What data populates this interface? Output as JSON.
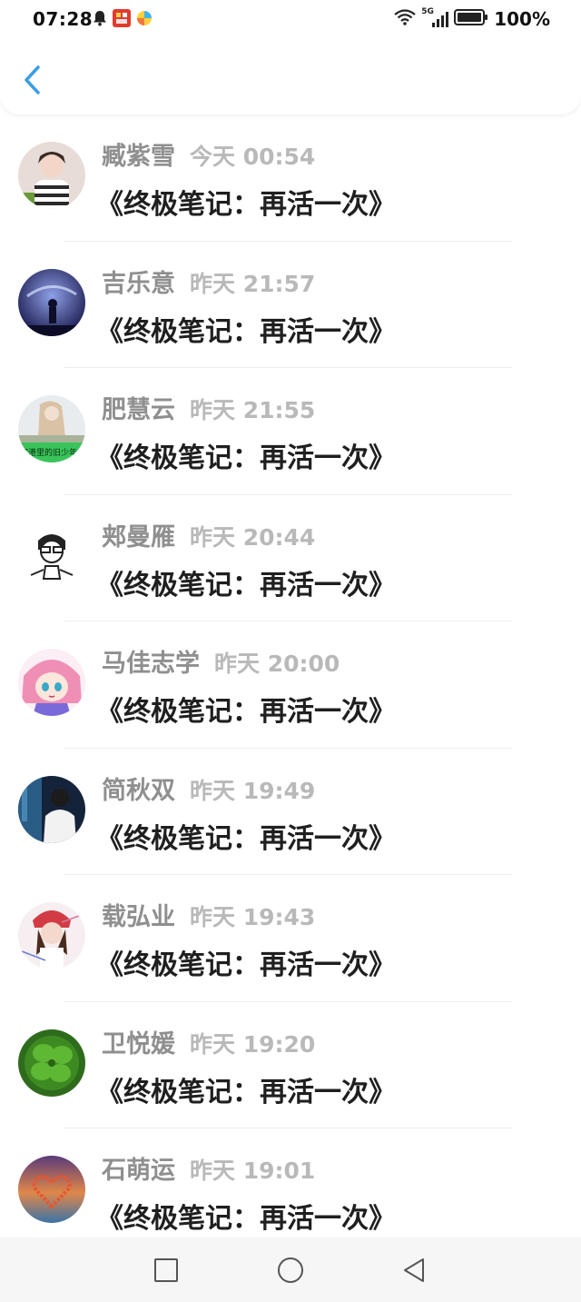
{
  "status_bar": {
    "time": "07:28",
    "network_label": "5G",
    "battery": "100%",
    "icons": [
      "bell-icon",
      "app-red-icon",
      "app-color-icon",
      "wifi-icon",
      "signal-icon",
      "battery-icon"
    ]
  },
  "header": {
    "back_icon": "chevron-left-icon",
    "accent": "#3a9ee4"
  },
  "messages": [
    {
      "name": "臧紫雪",
      "time": "今天 00:54",
      "text": "《终极笔记：再活一次》"
    },
    {
      "name": "吉乐意",
      "time": "昨天 21:57",
      "text": "《终极笔记：再活一次》"
    },
    {
      "name": "肥慧云",
      "time": "昨天 21:55",
      "text": "《终极笔记：再活一次》"
    },
    {
      "name": "郏曼雁",
      "time": "昨天 20:44",
      "text": "《终极笔记：再活一次》"
    },
    {
      "name": "马佳志学",
      "time": "昨天 20:00",
      "text": "《终极笔记：再活一次》"
    },
    {
      "name": "简秋双",
      "time": "昨天 19:49",
      "text": "《终极笔记：再活一次》"
    },
    {
      "name": "载弘业",
      "time": "昨天 19:43",
      "text": "《终极笔记：再活一次》"
    },
    {
      "name": "卫悦媛",
      "time": "昨天 19:20",
      "text": "《终极笔记：再活一次》"
    },
    {
      "name": "石萌运",
      "time": "昨天 19:01",
      "text": "《终极笔记：再活一次》"
    }
  ],
  "avatar_text": "家港里的旧少年",
  "nav": {
    "icons": [
      "recent-apps-icon",
      "home-icon",
      "back-triangle-icon"
    ]
  }
}
